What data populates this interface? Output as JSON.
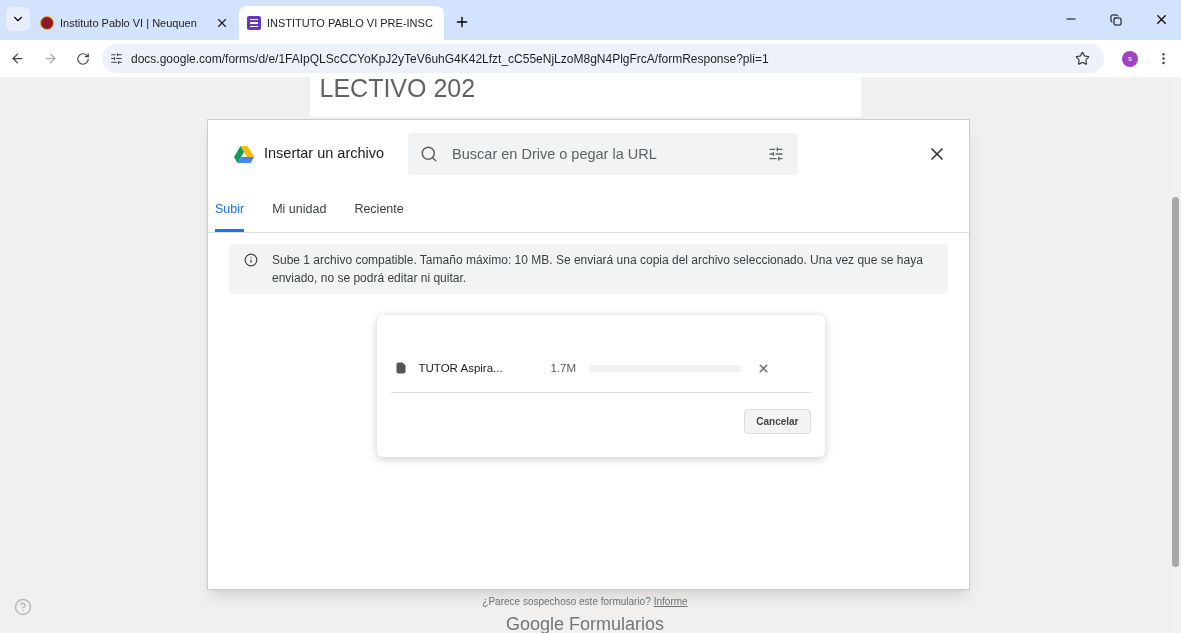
{
  "browser": {
    "tabs": [
      {
        "title": "Instituto Pablo VI | Neuquen",
        "selected": false
      },
      {
        "title": "INSTITUTO PABLO VI PRE-INSC",
        "selected": true
      }
    ],
    "url": "docs.google.com/forms/d/e/1FAIpQLScCCYoKpJ2yTeV6uhG4K42Lfzt_cC55eNjLzoM8gN4PlgFrcA/formResponse?pli=1",
    "profile": "s"
  },
  "form": {
    "heading": "LECTIVO 202",
    "report_text": "¿Parece sospechoso este formulario?",
    "report_link": "Informe",
    "footer_logo": "Google Formularios"
  },
  "picker": {
    "title": "Insertar un archivo",
    "search": {
      "placeholder": "Buscar en Drive o pegar la URL"
    },
    "tabs": [
      {
        "label": "Subir",
        "selected": true
      },
      {
        "label": "Mi unidad",
        "selected": false
      },
      {
        "label": "Reciente",
        "selected": false
      }
    ],
    "notice": "Sube 1 archivo compatible. Tamaño máximo: 10 MB. Se enviará una copia del archivo seleccionado. Una vez que se haya enviado, no se podrá editar ni quitar.",
    "upload": {
      "file_name": "TUTOR Aspira...",
      "size": "1.7M",
      "level": 0,
      "cancel": "Cancelar"
    }
  }
}
